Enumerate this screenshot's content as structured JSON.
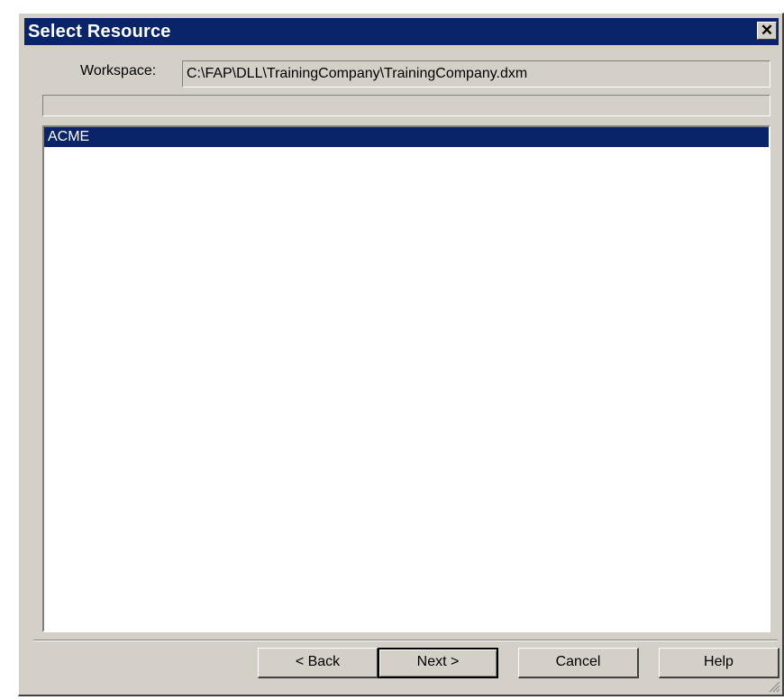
{
  "window": {
    "title": "Select Resource",
    "close_glyph": "✕"
  },
  "workspace": {
    "label": "Workspace:",
    "path": "C:\\FAP\\DLL\\TrainingCompany\\TrainingCompany.dxm"
  },
  "status": {
    "text": ""
  },
  "resources": {
    "items": [
      {
        "label": "ACME",
        "selected": true
      }
    ]
  },
  "buttons": {
    "back": "< Back",
    "next": "Next >",
    "cancel": "Cancel",
    "help": "Help"
  },
  "colors": {
    "titlebar_bg": "#0a246a",
    "selection_bg": "#0a246a",
    "dialog_bg": "#d4d0c8"
  },
  "icons": {
    "close": "close-icon",
    "resize_grip": "resize-grip-icon"
  }
}
